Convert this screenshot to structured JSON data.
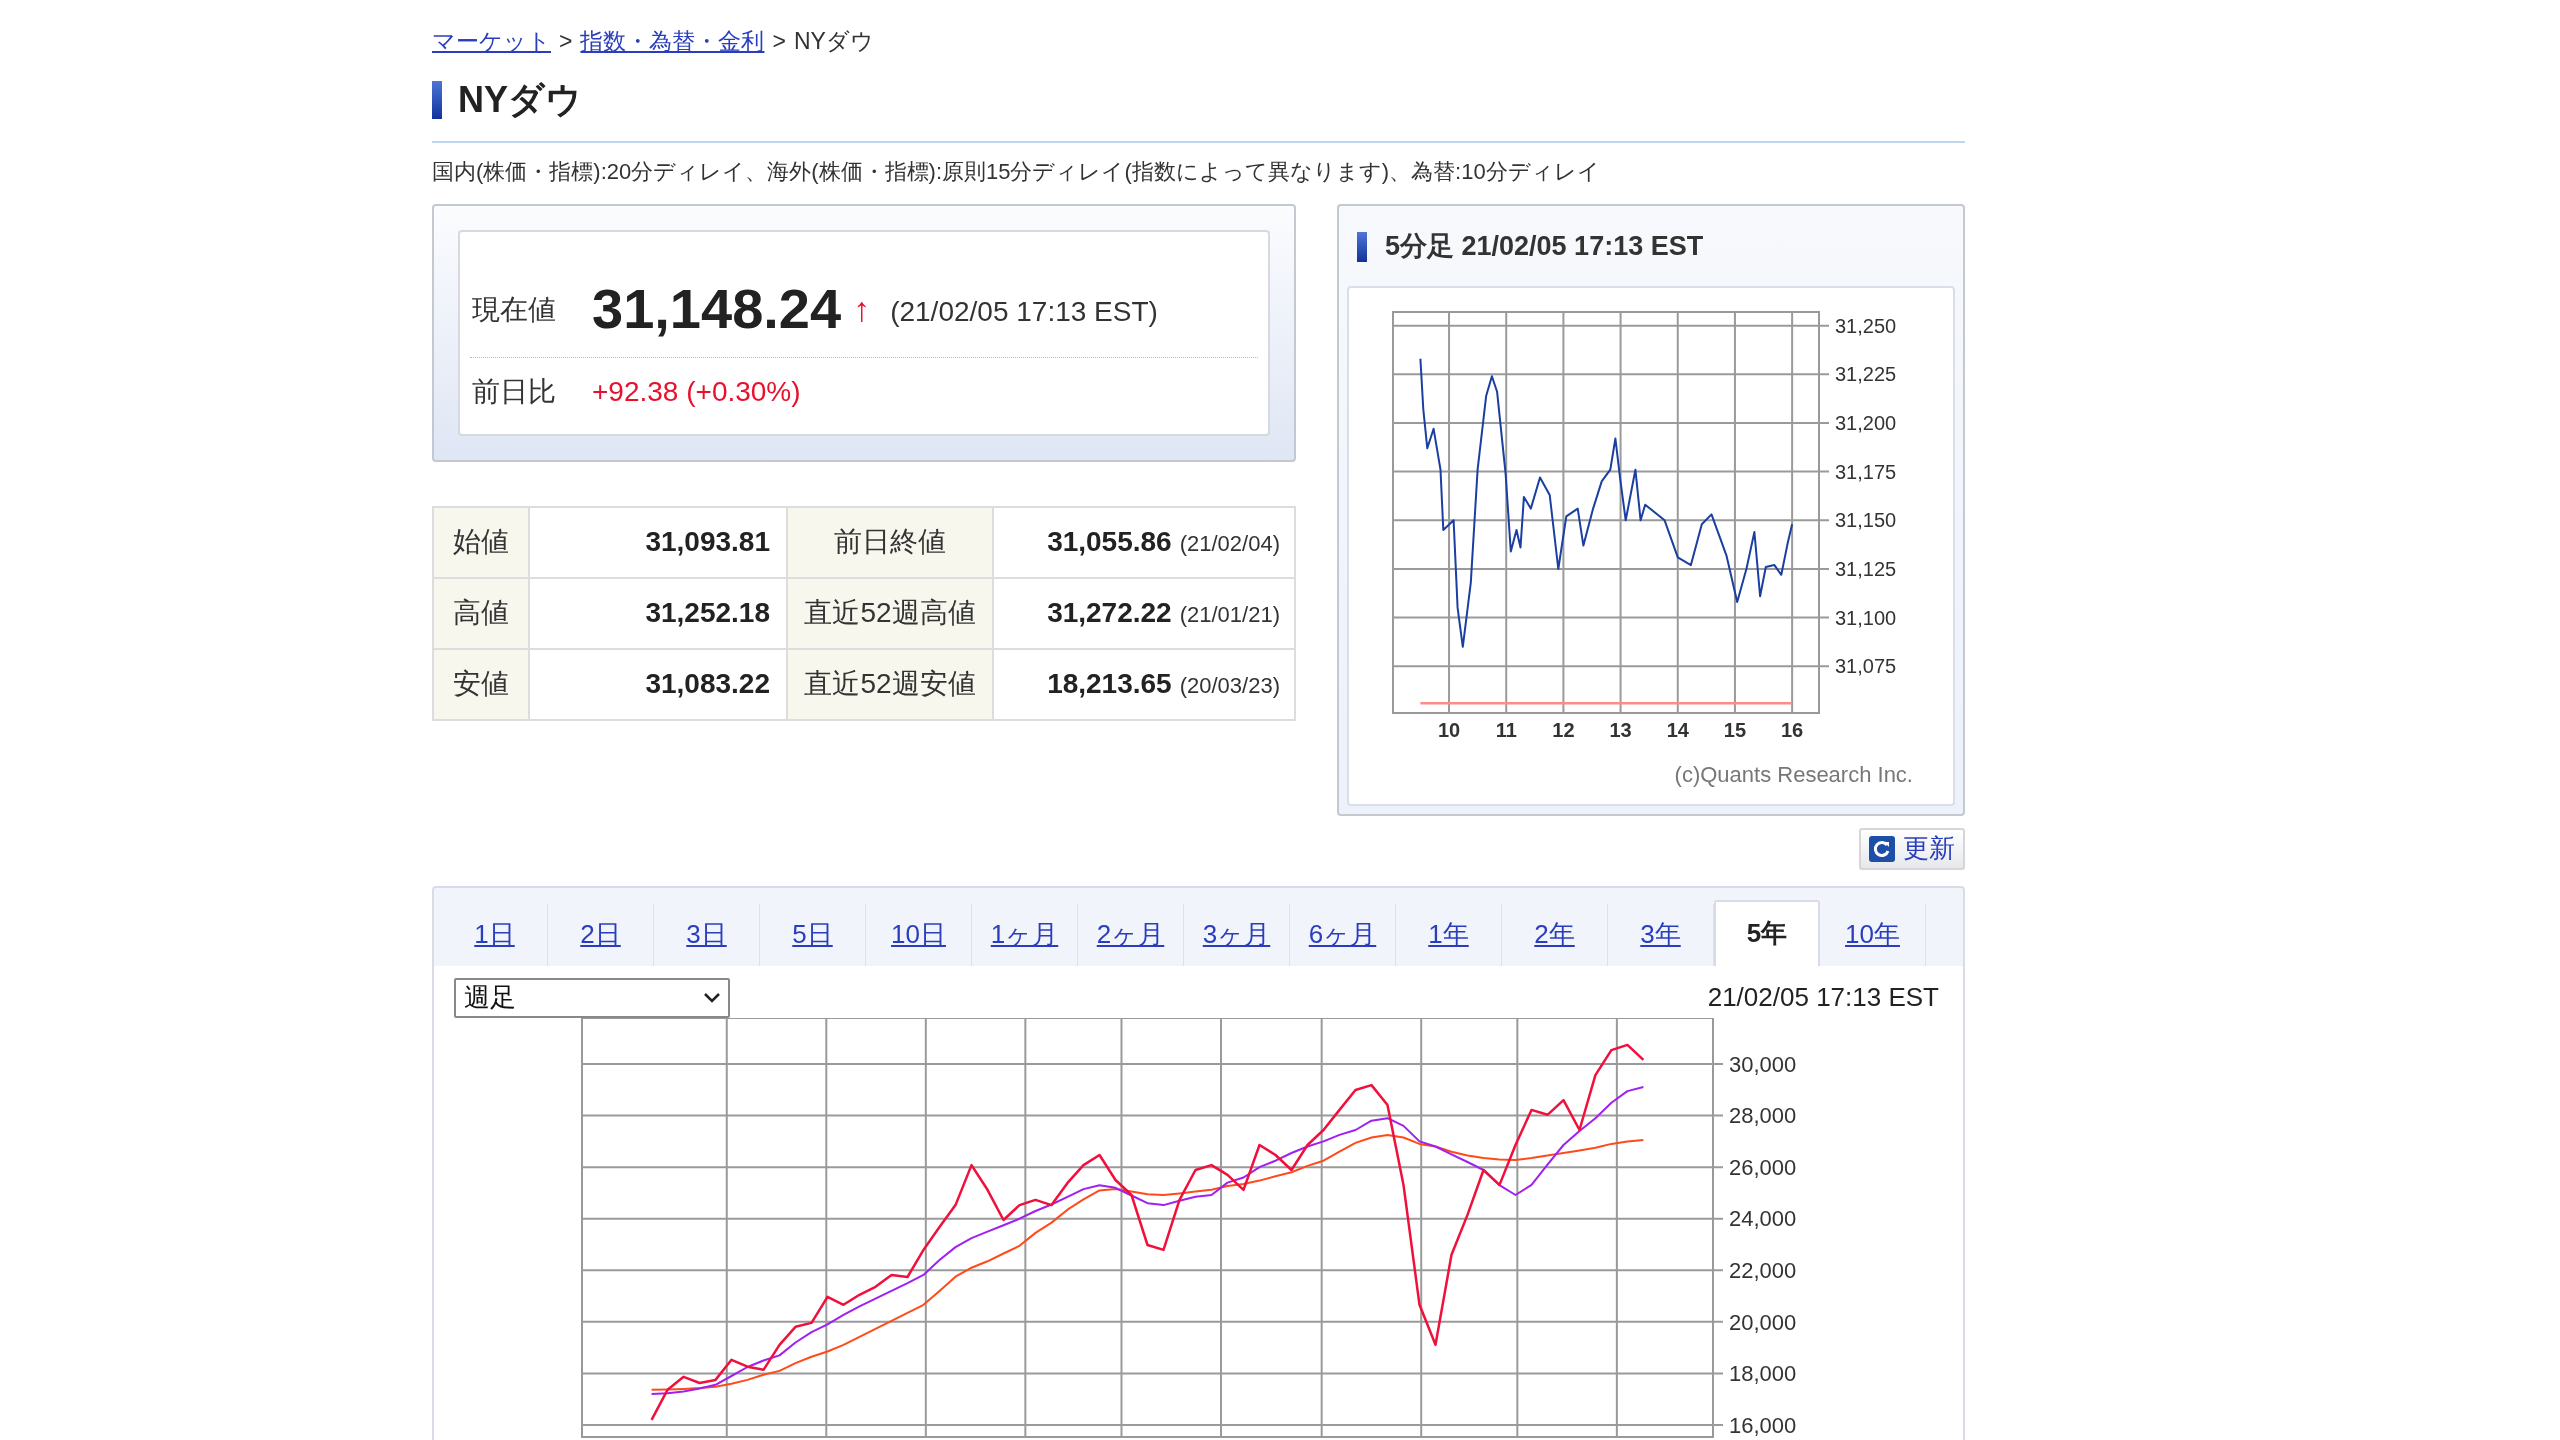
{
  "breadcrumb": {
    "separator": ">",
    "items": [
      {
        "label": "マーケット",
        "link": true
      },
      {
        "label": "指数・為替・金利",
        "link": true
      },
      {
        "label": "NYダウ",
        "link": false
      }
    ]
  },
  "title": "NYダウ",
  "delay_note": "国内(株価・指標):20分ディレイ、海外(株価・指標):原則15分ディレイ(指数によって異なります)、為替:10分ディレイ",
  "quote": {
    "price_label": "現在値",
    "price": "31,148.24",
    "arrow": "↑",
    "time": "(21/02/05 17:13 EST)",
    "change_label": "前日比",
    "change": "+92.38 (+0.30%)"
  },
  "stats": [
    {
      "label": "始値",
      "value": "31,093.81",
      "label_2": "前日終値",
      "value_2": "31,055.86",
      "date_2": "(21/02/04)"
    },
    {
      "label": "高値",
      "value": "31,252.18",
      "label_2": "直近52週高値",
      "value_2": "31,272.22",
      "date_2": "(21/01/21)"
    },
    {
      "label": "安値",
      "value": "31,083.22",
      "label_2": "直近52週安値",
      "value_2": "18,213.65",
      "date_2": "(20/03/23)"
    }
  ],
  "intraday": {
    "title": "5分足 21/02/05 17:13 EST",
    "credit": "(c)Quants Research Inc.",
    "chart_data": {
      "type": "line",
      "xlim": [
        9.02,
        16.47
      ],
      "ylim": [
        31051,
        31257
      ],
      "grid": true,
      "xticks": [
        10,
        11,
        12,
        13,
        14,
        15,
        16
      ],
      "yticks": [
        {
          "value": 31250,
          "label": "31,250"
        },
        {
          "value": 31225,
          "label": "31,225"
        },
        {
          "value": 31200,
          "label": "31,200"
        },
        {
          "value": 31175,
          "label": "31,175"
        },
        {
          "value": 31150,
          "label": "31,150"
        },
        {
          "value": 31125,
          "label": "31,125"
        },
        {
          "value": 31100,
          "label": "31,100"
        },
        {
          "value": 31075,
          "label": "31,075"
        }
      ],
      "x": [
        9.5,
        9.55,
        9.62,
        9.73,
        9.85,
        9.9,
        10.08,
        10.15,
        10.24,
        10.38,
        10.5,
        10.65,
        10.75,
        10.84,
        10.99,
        11.08,
        11.18,
        11.25,
        11.31,
        11.43,
        11.59,
        11.76,
        11.91,
        12.05,
        12.25,
        12.35,
        12.52,
        12.67,
        12.82,
        12.91,
        12.99,
        13.09,
        13.26,
        13.35,
        13.43,
        13.77,
        14.0,
        14.23,
        14.42,
        14.59,
        14.85,
        15.04,
        15.2,
        15.34,
        15.44,
        15.54,
        15.69,
        15.81,
        15.92,
        16.0
      ],
      "series": [
        {
          "color": "#ff8a8a",
          "values": [
            31056,
            31056,
            31056,
            31056,
            31056,
            31056,
            31056,
            31056,
            31056,
            31056,
            31056,
            31056,
            31056,
            31056,
            31056,
            31056,
            31056,
            31056,
            31056,
            31056,
            31056,
            31056,
            31056,
            31056,
            31056,
            31056,
            31056,
            31056,
            31056,
            31056,
            31056,
            31056,
            31056,
            31056,
            31056,
            31056,
            31056,
            31056,
            31056,
            31056,
            31056,
            31056,
            31056,
            31056,
            31056,
            31056,
            31056,
            31056,
            31056,
            31056
          ]
        },
        {
          "color": "#1a3fa0",
          "values": [
            31233,
            31207,
            31187,
            31197,
            31176,
            31145,
            31150,
            31105,
            31085,
            31118,
            31176,
            31214,
            31224,
            31216,
            31174,
            31134,
            31145,
            31136,
            31162,
            31156,
            31172,
            31163,
            31125,
            31152,
            31156,
            31137,
            31156,
            31170,
            31176,
            31192,
            31172,
            31150,
            31176,
            31150,
            31158,
            31150,
            31131,
            31127,
            31148,
            31153,
            31132,
            31108,
            31125,
            31144,
            31111,
            31126,
            31127,
            31122,
            31138,
            31148
          ]
        }
      ]
    }
  },
  "refresh_button": "更新",
  "tabs": [
    {
      "label": "1日",
      "selected": false
    },
    {
      "label": "2日",
      "selected": false
    },
    {
      "label": "3日",
      "selected": false
    },
    {
      "label": "5日",
      "selected": false
    },
    {
      "label": "10日",
      "selected": false
    },
    {
      "label": "1ヶ月",
      "selected": false
    },
    {
      "label": "2ヶ月",
      "selected": false
    },
    {
      "label": "3ヶ月",
      "selected": false
    },
    {
      "label": "6ヶ月",
      "selected": false
    },
    {
      "label": "1年",
      "selected": false
    },
    {
      "label": "2年",
      "selected": false
    },
    {
      "label": "3年",
      "selected": false
    },
    {
      "label": "5年",
      "selected": true
    },
    {
      "label": "10年",
      "selected": false
    }
  ],
  "interval_select": {
    "value": "週足"
  },
  "chart_time": "21/02/05 17:13 EST",
  "long_chart": {
    "chart_data": {
      "type": "line",
      "grid": true,
      "ylim": [
        15535,
        31784
      ],
      "categories": [
        null,
        null,
        null,
        null,
        null,
        null,
        null,
        null,
        null,
        null,
        null,
        null,
        null,
        null,
        null,
        null,
        null,
        null,
        null,
        null,
        null,
        null,
        null,
        null,
        null,
        null,
        null,
        null,
        null,
        null,
        null,
        null,
        null,
        null,
        null,
        null,
        null,
        null,
        null,
        null,
        null,
        null,
        null,
        null,
        null,
        null,
        null,
        null,
        null,
        null,
        null,
        null,
        null,
        null,
        null,
        null,
        null,
        null,
        null,
        null,
        null,
        null,
        null
      ],
      "yticks": [
        {
          "value": 30000,
          "label": "30,000"
        },
        {
          "value": 28000,
          "label": "28,000"
        },
        {
          "value": 26000,
          "label": "26,000"
        },
        {
          "value": 24000,
          "label": "24,000"
        },
        {
          "value": 22000,
          "label": "22,000"
        },
        {
          "value": 20000,
          "label": "20,000"
        },
        {
          "value": 18000,
          "label": "18,000"
        },
        {
          "value": 16000,
          "label": "16,000"
        }
      ],
      "series": [
        {
          "color": "#f0103c",
          "values": [
            16200,
            17370,
            17870,
            17630,
            17750,
            18530,
            18260,
            18140,
            19110,
            19810,
            19960,
            20970,
            20660,
            21050,
            21360,
            21820,
            21740,
            22790,
            23680,
            24530,
            26080,
            25120,
            23950,
            24530,
            24730,
            24530,
            25390,
            26080,
            26470,
            25500,
            24920,
            22980,
            22790,
            24730,
            25890,
            26080,
            25700,
            25120,
            26860,
            26470,
            25890,
            26860,
            27440,
            28220,
            28990,
            29180,
            28410,
            25310,
            20660,
            19110,
            22600,
            24150,
            25890,
            25310,
            26860,
            28220,
            28030,
            28600,
            27440,
            29570,
            30540,
            30740,
            30160
          ]
        },
        {
          "color": "#a020f0",
          "values": [
            17200,
            17230,
            17300,
            17420,
            17560,
            17900,
            18250,
            18500,
            18700,
            19200,
            19600,
            19900,
            20270,
            20600,
            20900,
            21200,
            21500,
            21820,
            22400,
            22900,
            23250,
            23500,
            23750,
            24000,
            24300,
            24550,
            24850,
            25150,
            25300,
            25200,
            24900,
            24600,
            24530,
            24700,
            24850,
            24920,
            25400,
            25600,
            26000,
            26250,
            26550,
            26800,
            27000,
            27250,
            27440,
            27800,
            27900,
            27600,
            27000,
            26800,
            26500,
            26200,
            25890,
            25300,
            24920,
            25310,
            26100,
            26860,
            27400,
            27900,
            28500,
            28950,
            29110
          ]
        },
        {
          "color": "#ff4a1a",
          "values": [
            17370,
            17380,
            17400,
            17430,
            17480,
            17600,
            17750,
            17950,
            18100,
            18400,
            18650,
            18850,
            19110,
            19420,
            19730,
            20040,
            20350,
            20660,
            21200,
            21750,
            22100,
            22350,
            22650,
            22950,
            23450,
            23850,
            24350,
            24750,
            25100,
            25150,
            25050,
            24950,
            24920,
            24980,
            25050,
            25120,
            25270,
            25350,
            25480,
            25650,
            25800,
            26050,
            26250,
            26600,
            26940,
            27150,
            27250,
            27150,
            26900,
            26800,
            26600,
            26450,
            26350,
            26300,
            26280,
            26350,
            26450,
            26550,
            26650,
            26750,
            26900,
            27000,
            27050
          ]
        }
      ]
    }
  }
}
